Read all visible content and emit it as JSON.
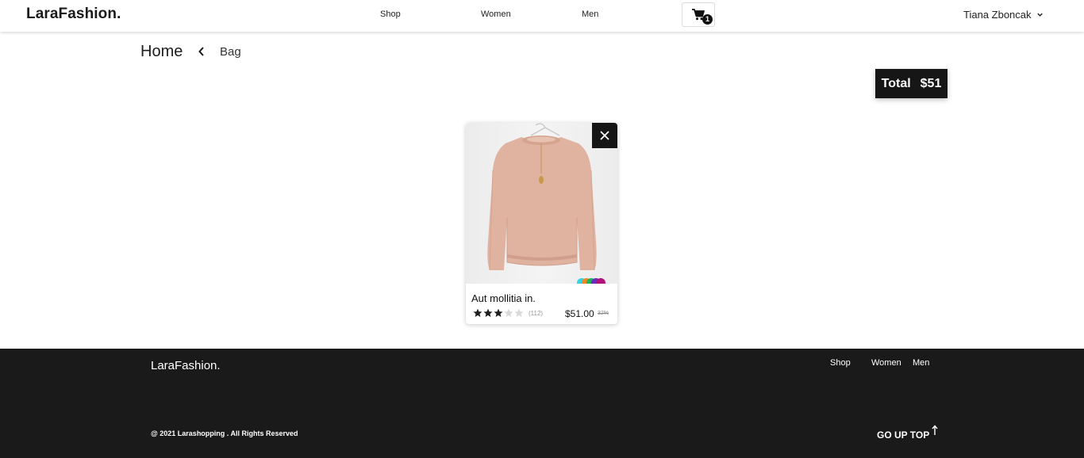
{
  "header": {
    "brand": "LaraFashion.",
    "nav": [
      "Shop",
      "Women",
      "Men"
    ],
    "cart_count": "1",
    "user_name": "Tiana Zboncak"
  },
  "breadcrumb": {
    "home": "Home",
    "current": "Bag"
  },
  "total": {
    "label": "Total",
    "amount": "$51"
  },
  "product": {
    "name": "Aut mollitia in.",
    "rating": 3,
    "rating_max": 5,
    "reviews": "(112)",
    "price": "$51.00",
    "discount": "32%",
    "swatch_colors": [
      "#33d6e0",
      "#f08a24",
      "#20b15a",
      "#6a2cc0",
      "#b0127a"
    ],
    "star_filled_color": "#1f1f1f",
    "star_empty_color": "#d9d9d9"
  },
  "footer": {
    "brand": "LaraFashion.",
    "nav": [
      "Shop",
      "Women",
      "Men"
    ],
    "copyright": "@ 2021 Larashopping . All Rights Reserved",
    "go_top": "GO UP TOP"
  },
  "colors": {
    "dark": "#161616",
    "sweater": "#e0b3a0"
  }
}
